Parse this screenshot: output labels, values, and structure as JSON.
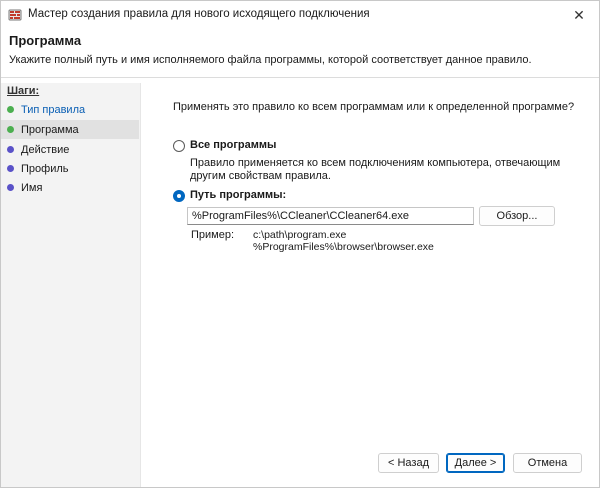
{
  "window": {
    "title": "Мастер создания правила для нового исходящего подключения",
    "close_glyph": "✕"
  },
  "header": {
    "title": "Программа",
    "subtitle": "Укажите полный путь и имя исполняемого файла программы, которой соответствует данное правило."
  },
  "sidebar": {
    "steps_label": "Шаги:",
    "items": [
      {
        "label": "Тип правила",
        "state": "done"
      },
      {
        "label": "Программа",
        "state": "current"
      },
      {
        "label": "Действие",
        "state": "todo"
      },
      {
        "label": "Профиль",
        "state": "todo"
      },
      {
        "label": "Имя",
        "state": "todo"
      }
    ]
  },
  "main": {
    "question": "Применять это правило ко всем программам или к определенной программе?",
    "all_programs": {
      "label": "Все программы",
      "description": "Правило применяется ко всем подключениям компьютера, отвечающим другим свойствам правила.",
      "selected": false
    },
    "program_path": {
      "label": "Путь программы:",
      "selected": true,
      "value": "%ProgramFiles%\\CCleaner\\CCleaner64.exe",
      "browse_label": "Обзор..."
    },
    "example": {
      "label": "Пример:",
      "lines": [
        "c:\\path\\program.exe",
        "%ProgramFiles%\\browser\\browser.exe"
      ]
    }
  },
  "footer": {
    "back_label": "< Назад",
    "next_label": "Далее >",
    "cancel_label": "Отмена"
  },
  "colors": {
    "accent": "#0067c0",
    "step_done": "#4caf50",
    "step_todo": "#5a52c8",
    "link": "#0a5fb4"
  },
  "icons": {
    "app": "firewall-icon",
    "close": "close-icon"
  }
}
